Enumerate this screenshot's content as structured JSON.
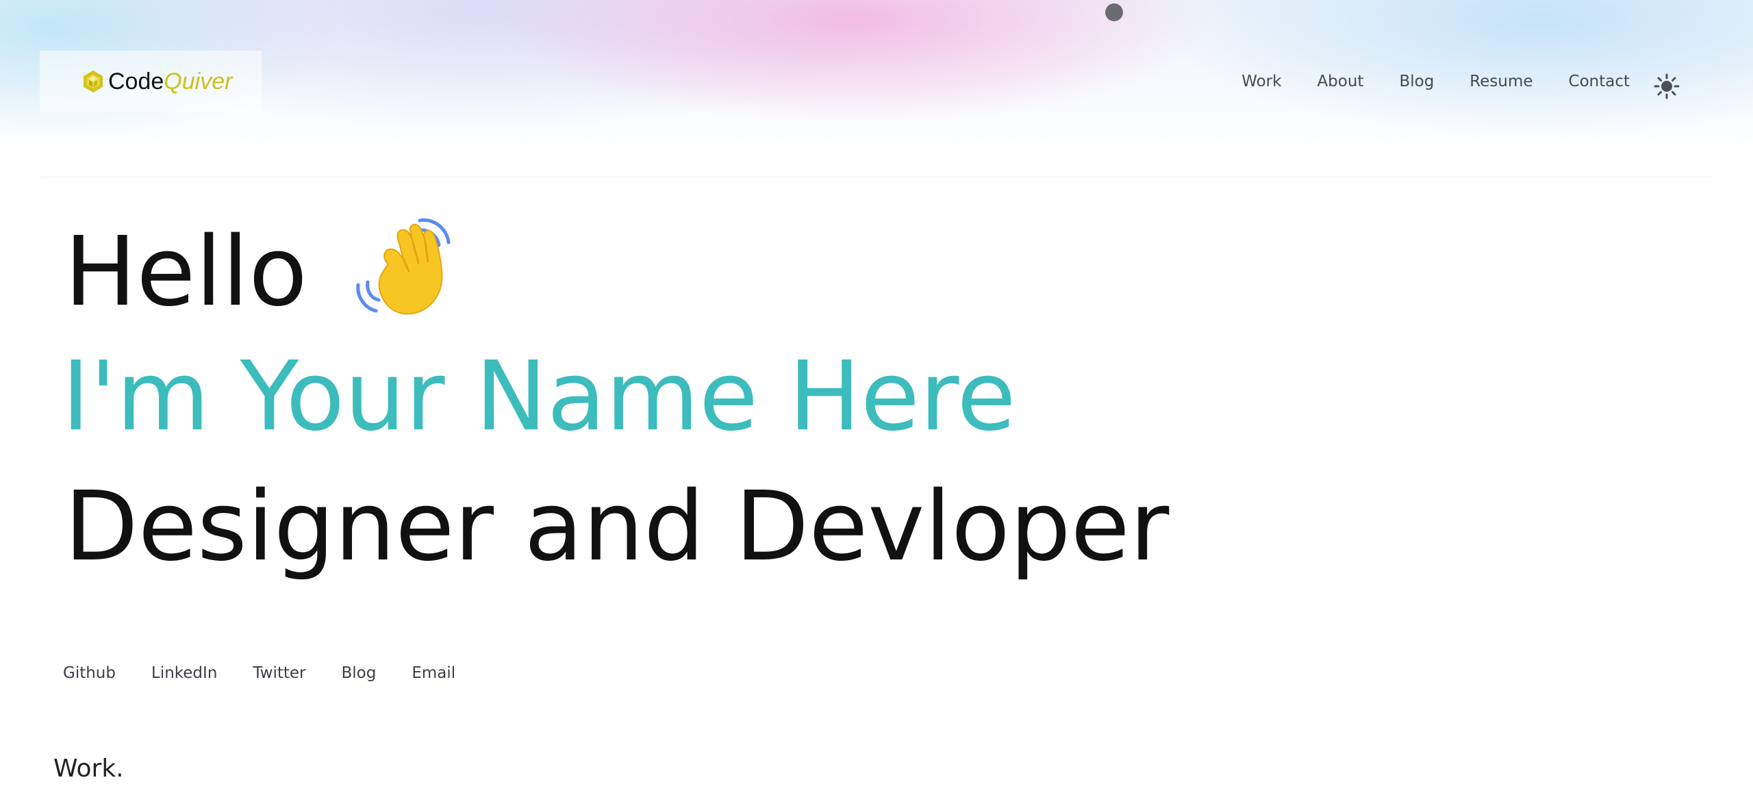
{
  "header": {
    "logo": {
      "text_main": "Code",
      "text_accent": "Quiver",
      "icon": "hexagon-logo-icon"
    },
    "nav_items": [
      {
        "label": "Work"
      },
      {
        "label": "About"
      },
      {
        "label": "Blog"
      },
      {
        "label": "Resume"
      },
      {
        "label": "Contact"
      }
    ],
    "theme_toggle_icon": "sun-icon"
  },
  "hero": {
    "greeting": "Hello",
    "greeting_icon": "waving-hand-icon",
    "name": "I'm Your Name Here",
    "role": "Designer and Devloper"
  },
  "social_links": [
    {
      "label": "Github"
    },
    {
      "label": "LinkedIn"
    },
    {
      "label": "Twitter"
    },
    {
      "label": "Blog"
    },
    {
      "label": "Email"
    }
  ],
  "sections": {
    "work_title": "Work."
  },
  "colors": {
    "accent_name": "#3cbcbc",
    "logo_accent": "#c9c21a",
    "text_dark": "#111111",
    "nav_text": "#444a52"
  }
}
